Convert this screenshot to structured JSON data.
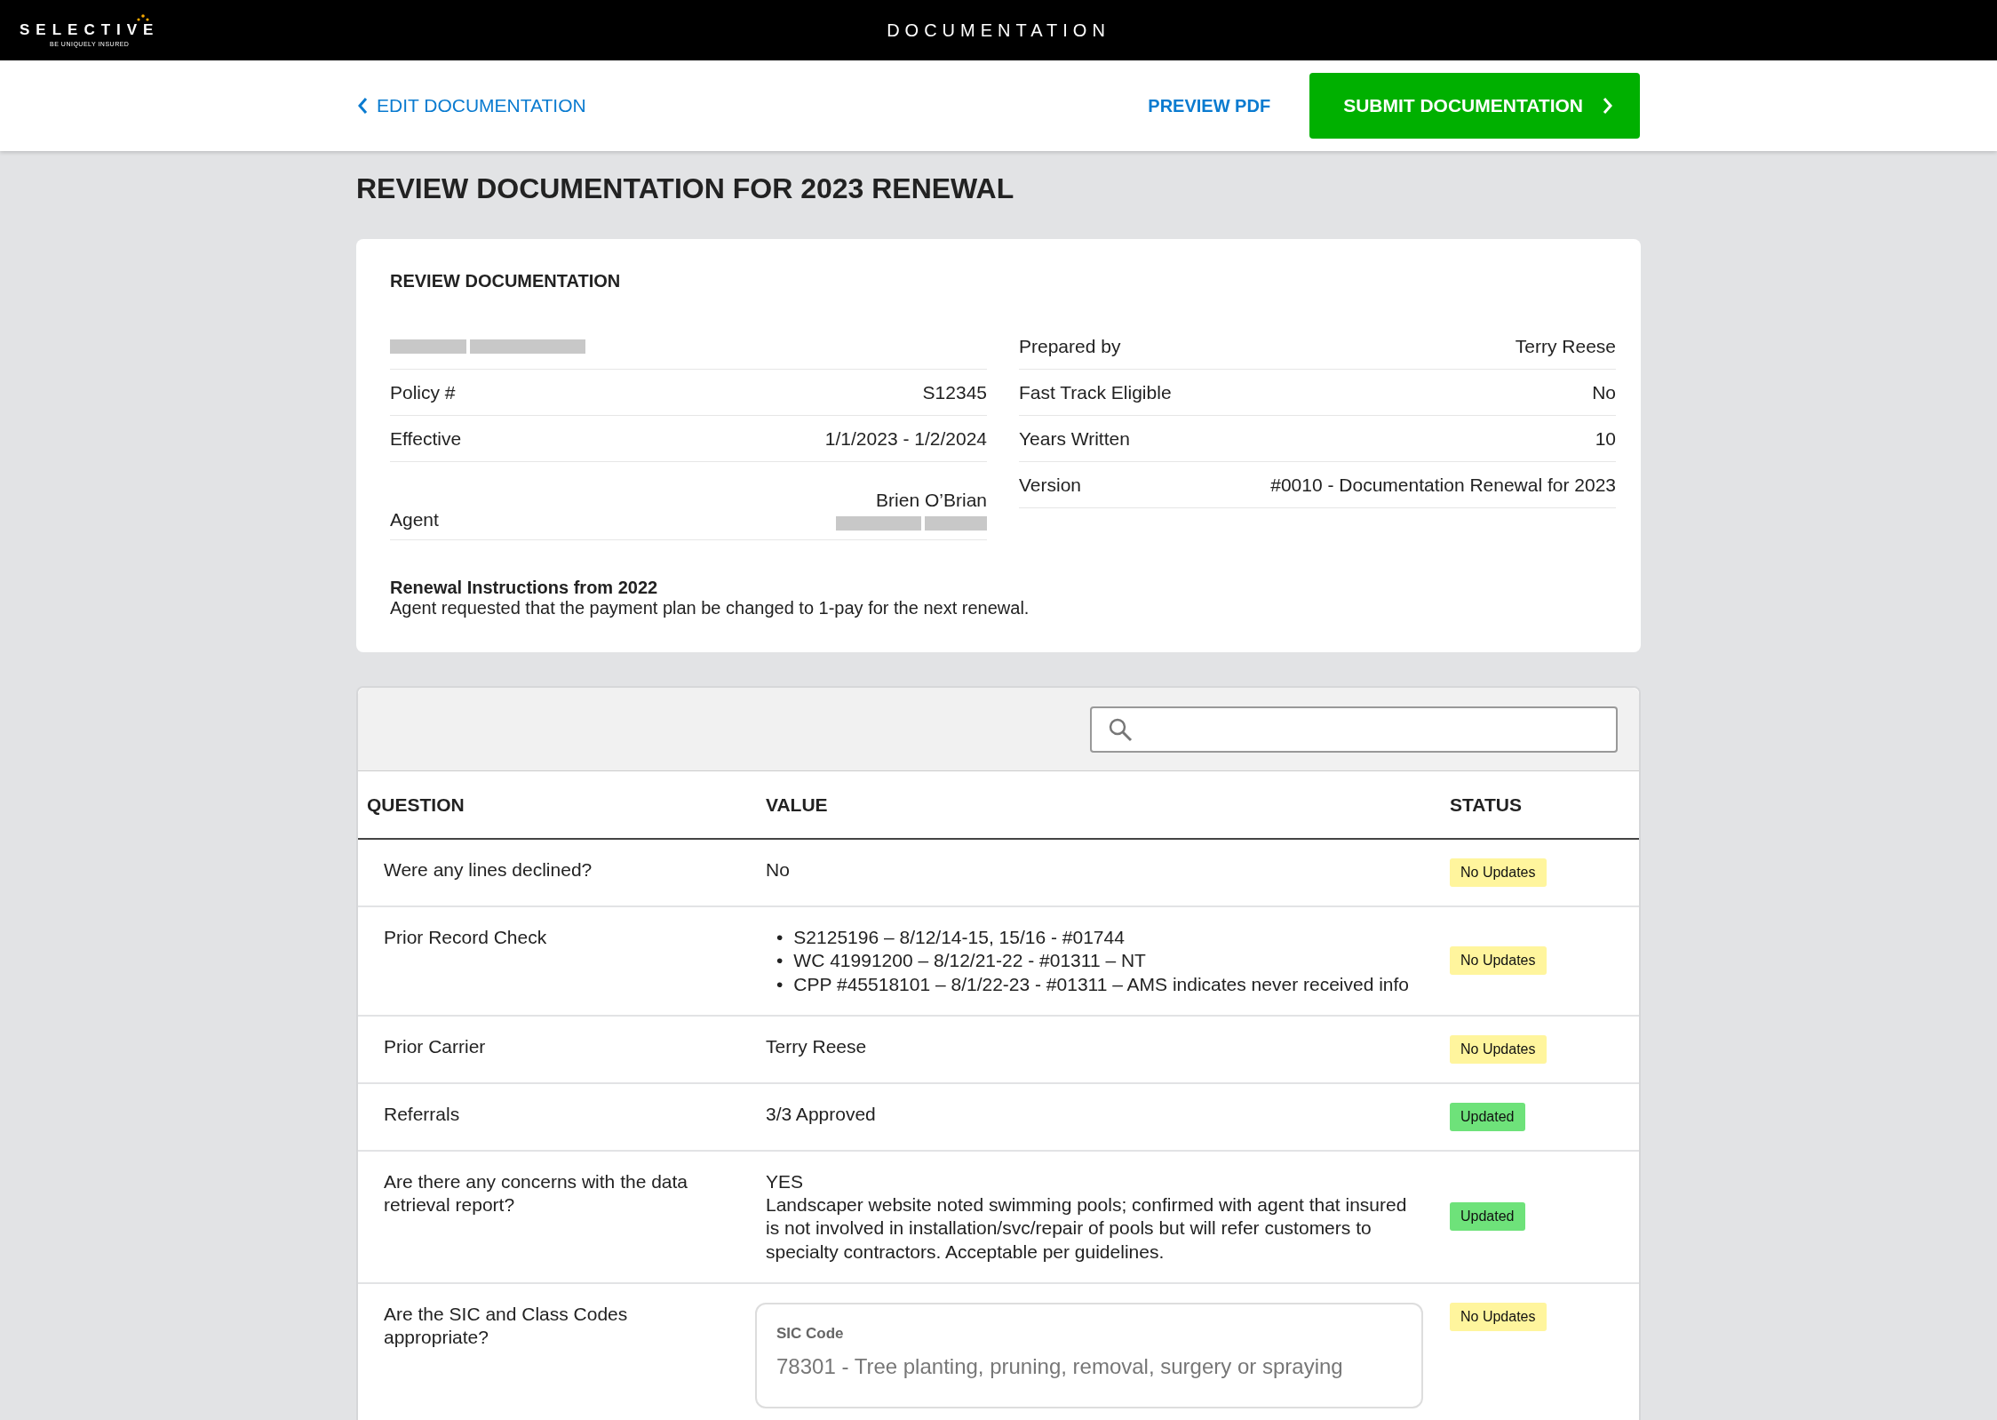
{
  "header": {
    "logo": "SELECTIVE",
    "tagline": "BE UNIQUELY INSURED",
    "title": "DOCUMENTATION"
  },
  "toolbar": {
    "back_link": "EDIT DOCUMENTATION",
    "preview_link": "PREVIEW PDF",
    "submit_button": "SUBMIT DOCUMENTATION"
  },
  "page_title": "REVIEW DOCUMENTATION FOR 2023 RENEWAL",
  "summary": {
    "title": "REVIEW DOCUMENTATION",
    "left": [
      {
        "kind": "redacted"
      },
      {
        "label": "Policy #",
        "value": "S12345"
      },
      {
        "label": "Effective",
        "value": "1/1/2023 - 1/2/2024"
      },
      {
        "label": "Agent",
        "value": "Brien O’Brian",
        "redacted_line": true
      }
    ],
    "right": [
      {
        "label": "Prepared by",
        "value": "Terry Reese"
      },
      {
        "label": "Fast Track Eligible",
        "value": "No"
      },
      {
        "label": "Years Written",
        "value": "10"
      },
      {
        "label": "Version",
        "value": "#0010 - Documentation Renewal for 2023"
      }
    ],
    "instructions_title": "Renewal Instructions from 2022",
    "instructions": "Agent requested that the payment plan be changed to 1-pay for the next renewal."
  },
  "table": {
    "columns": [
      "QUESTION",
      "VALUE",
      "STATUS"
    ],
    "rows": [
      {
        "question": "Were any lines declined?",
        "value": {
          "kind": "text",
          "text": "No"
        },
        "status": {
          "kind": "no_updates",
          "label": "No Updates"
        }
      },
      {
        "question": "Prior Record Check",
        "value": {
          "kind": "list",
          "items": [
            {
              "marker": "•",
              "text": "S2125196 – 8/12/14-15, 15/16 - #01744"
            },
            {
              "marker": "•",
              "text": "WC 41991200 – 8/12/21-22 - #01311 – NT"
            },
            {
              "marker": "•",
              "text": "CPP #45518101 – 8/1/22-23 - #01311 – AMS indicates never received info"
            }
          ]
        },
        "status": {
          "kind": "no_updates",
          "label": "No Updates"
        }
      },
      {
        "question": "Prior Carrier",
        "value": {
          "kind": "text",
          "text": "Terry Reese"
        },
        "status": {
          "kind": "no_updates",
          "label": "No Updates"
        }
      },
      {
        "question": "Referrals",
        "value": {
          "kind": "text",
          "text": "3/3 Approved"
        },
        "status": {
          "kind": "updated",
          "label": "Updated"
        }
      },
      {
        "question": "Are there any concerns with the data retrieval report?",
        "value": {
          "kind": "note",
          "heading": "YES",
          "text": "Landscaper website noted swimming pools; confirmed with agent that insured is not involved in installation/svc/repair of pools but will refer customers to specialty contractors. Acceptable per guidelines."
        },
        "status": {
          "kind": "updated",
          "label": "Updated"
        }
      },
      {
        "question": "Are the SIC and Class Codes appropriate?",
        "value": {
          "kind": "field",
          "label": "SIC Code",
          "text": "78301 - Tree planting, pruning, removal, surgery or spraying"
        },
        "status": {
          "kind": "no_updates",
          "label": "No Updates"
        }
      }
    ]
  }
}
